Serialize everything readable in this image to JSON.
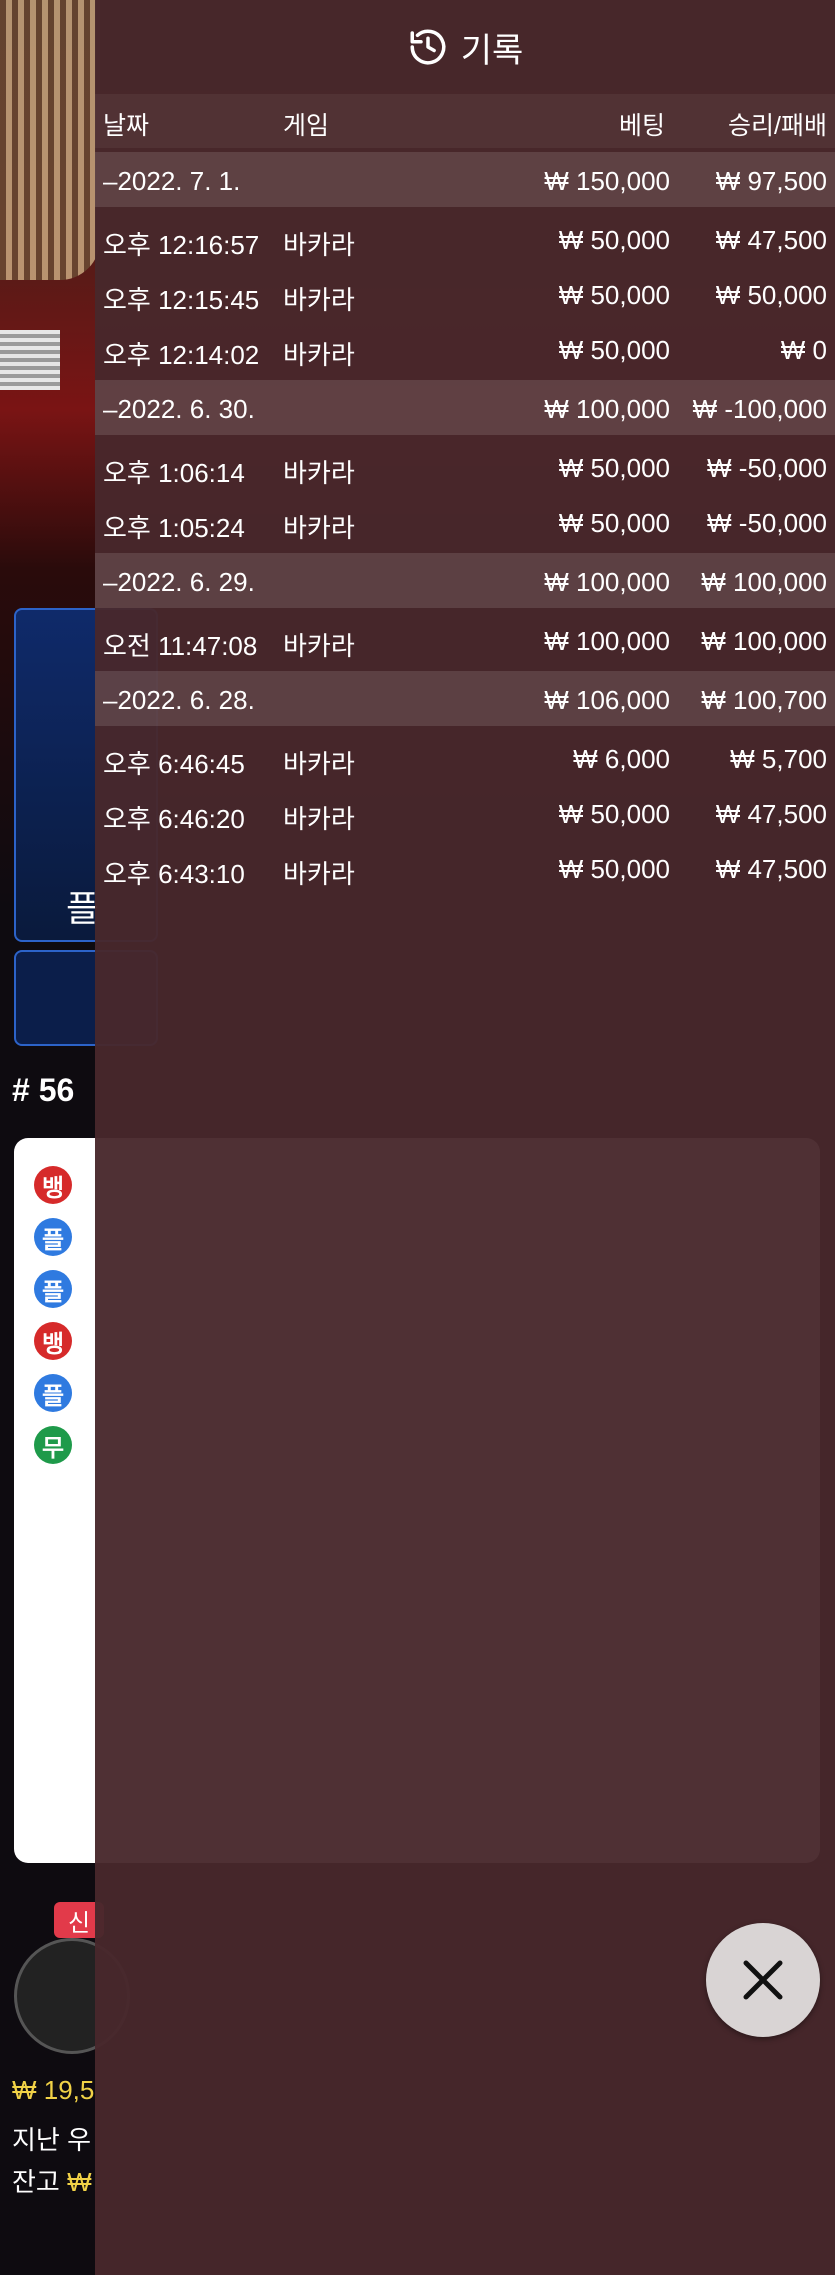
{
  "panel": {
    "title": "기록",
    "columns": {
      "date": "날짜",
      "game": "게임",
      "bet": "베팅",
      "result": "승리/패배"
    },
    "rows": [
      {
        "type": "group",
        "date": "–2022. 7. 1.",
        "game": "",
        "bet": "₩ 150,000",
        "result": "₩ 97,500"
      },
      {
        "type": "item",
        "date": "오후 12:16:57",
        "game": "바카라",
        "bet": "₩ 50,000",
        "result": "₩ 47,500"
      },
      {
        "type": "item",
        "date": "오후 12:15:45",
        "game": "바카라",
        "bet": "₩ 50,000",
        "result": "₩ 50,000"
      },
      {
        "type": "item",
        "date": "오후 12:14:02",
        "game": "바카라",
        "bet": "₩ 50,000",
        "result": "₩ 0"
      },
      {
        "type": "group",
        "date": "–2022. 6. 30.",
        "game": "",
        "bet": "₩ 100,000",
        "result": "₩ -100,000"
      },
      {
        "type": "item",
        "date": "오후 1:06:14",
        "game": "바카라",
        "bet": "₩ 50,000",
        "result": "₩ -50,000"
      },
      {
        "type": "item",
        "date": "오후 1:05:24",
        "game": "바카라",
        "bet": "₩ 50,000",
        "result": "₩ -50,000"
      },
      {
        "type": "group",
        "date": "–2022. 6. 29.",
        "game": "",
        "bet": "₩ 100,000",
        "result": "₩ 100,000"
      },
      {
        "type": "item",
        "date": "오전 11:47:08",
        "game": "바카라",
        "bet": "₩ 100,000",
        "result": "₩ 100,000"
      },
      {
        "type": "group",
        "date": "–2022. 6. 28.",
        "game": "",
        "bet": "₩ 106,000",
        "result": "₩ 100,700"
      },
      {
        "type": "item",
        "date": "오후 6:46:45",
        "game": "바카라",
        "bet": "₩ 6,000",
        "result": "₩ 5,700"
      },
      {
        "type": "item",
        "date": "오후 6:46:20",
        "game": "바카라",
        "bet": "₩ 50,000",
        "result": "₩ 47,500"
      },
      {
        "type": "item",
        "date": "오후 6:43:10",
        "game": "바카라",
        "bet": "₩ 50,000",
        "result": "₩ 47,500"
      }
    ]
  },
  "background": {
    "player_label": "플",
    "round_number": "# 56",
    "beads": [
      "뱅",
      "플",
      "플",
      "뱅",
      "플",
      "무"
    ],
    "new_badge": "신",
    "stats": {
      "bet_amount": "₩ 19,5",
      "last_win_label": "지난 우",
      "balance_label": "잔고",
      "balance_amount": "₩"
    }
  }
}
